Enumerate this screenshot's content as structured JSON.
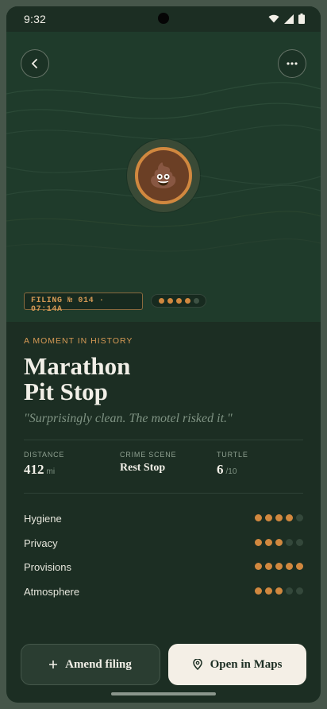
{
  "status_bar": {
    "time": "9:32"
  },
  "header": {
    "back_icon": "chevron-left-icon",
    "more_icon": "more-horizontal-icon"
  },
  "hero": {
    "emblem_glyph": "💩",
    "filing_tag": "FILING № 014 · 07:14A",
    "pager": {
      "total": 5,
      "active_count": 4
    }
  },
  "entry": {
    "eyebrow": "A MOMENT IN HISTORY",
    "title_line1": "Marathon",
    "title_line2": "Pit Stop",
    "quote": "\"Surprisingly clean. The motel risked it.\""
  },
  "stats": [
    {
      "label": "DISTANCE",
      "value": "412",
      "unit": "mi"
    },
    {
      "label": "CRIME SCENE",
      "value": "Rest Stop",
      "unit": ""
    },
    {
      "label": "TURTLE",
      "value": "6",
      "unit": "/10"
    }
  ],
  "ratings": [
    {
      "label": "Hygiene",
      "score": 4,
      "max": 5
    },
    {
      "label": "Privacy",
      "score": 3,
      "max": 5
    },
    {
      "label": "Provisions",
      "score": 5,
      "max": 5
    },
    {
      "label": "Atmosphere",
      "score": 3,
      "max": 5
    }
  ],
  "actions": {
    "amend_label": "Amend filing",
    "maps_label": "Open in Maps"
  },
  "colors": {
    "accent": "#d1883f",
    "background": "#1c2e23",
    "hero": "#1f3b2b",
    "text": "#f1efe7"
  }
}
